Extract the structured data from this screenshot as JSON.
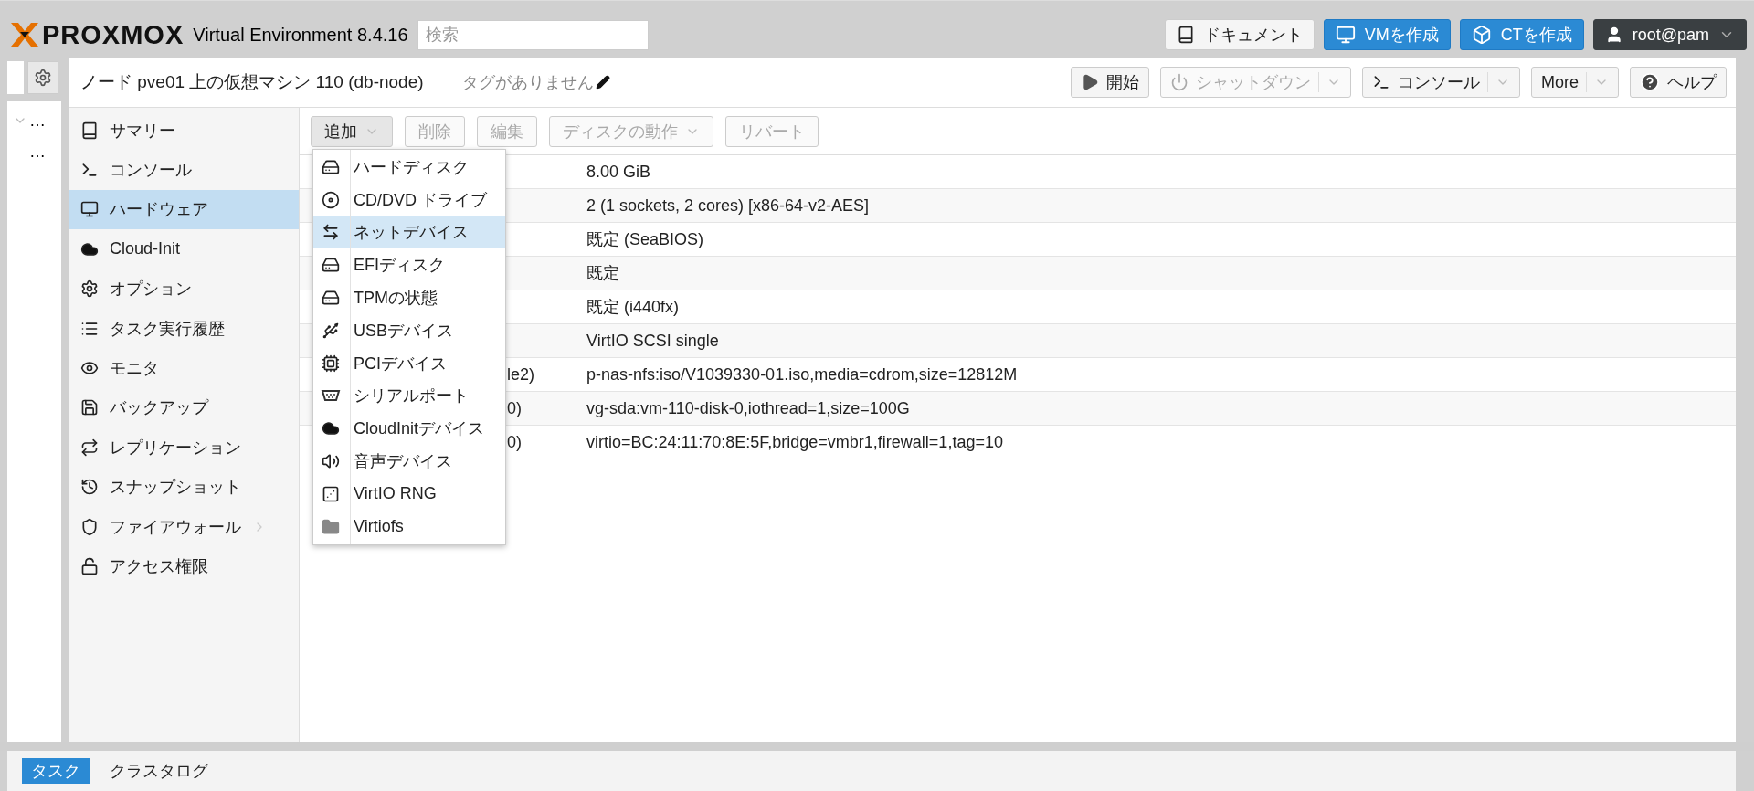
{
  "header": {
    "logo": "PROXMOX",
    "product": "Virtual Environment 8.4.16",
    "search": {
      "placeholder": "検索"
    },
    "buttons": [
      {
        "label": "ドキュメント",
        "kind": "docs"
      },
      {
        "label": "VMを作成",
        "kind": "vm"
      },
      {
        "label": "CTを作成",
        "kind": "ct"
      },
      {
        "label": "root@pam",
        "kind": "user"
      }
    ]
  },
  "tree": [
    {
      "label": "…",
      "expanded": true
    },
    {
      "label": "…",
      "expanded": false
    }
  ],
  "title_bar": {
    "title": "ノード pve01 上の仮想マシン 110 (db-node)",
    "tags": "タグがありません",
    "buttons": [
      {
        "label": "開始",
        "disabled": false,
        "dropdown": false
      },
      {
        "label": "シャットダウン",
        "disabled": true,
        "dropdown": true
      },
      {
        "label": "コンソール",
        "disabled": false,
        "dropdown": true
      },
      {
        "label": "More",
        "disabled": false,
        "dropdown": true
      },
      {
        "label": "ヘルプ",
        "disabled": false,
        "dropdown": false
      }
    ]
  },
  "nav": [
    {
      "label": "サマリー",
      "selected": false,
      "submenu": false
    },
    {
      "label": "コンソール",
      "selected": false,
      "submenu": false
    },
    {
      "label": "ハードウェア",
      "selected": true,
      "submenu": false
    },
    {
      "label": "Cloud-Init",
      "selected": false,
      "submenu": false
    },
    {
      "label": "オプション",
      "selected": false,
      "submenu": false
    },
    {
      "label": "タスク実行履歴",
      "selected": false,
      "submenu": false
    },
    {
      "label": "モニタ",
      "selected": false,
      "submenu": false
    },
    {
      "label": "バックアップ",
      "selected": false,
      "submenu": false
    },
    {
      "label": "レプリケーション",
      "selected": false,
      "submenu": false
    },
    {
      "label": "スナップショット",
      "selected": false,
      "submenu": false
    },
    {
      "label": "ファイアウォール",
      "selected": false,
      "submenu": true
    },
    {
      "label": "アクセス権限",
      "selected": false,
      "submenu": false
    }
  ],
  "toolbar": [
    {
      "label": "追加",
      "disabled": false,
      "dropdown": true
    },
    {
      "label": "削除",
      "disabled": true,
      "dropdown": false
    },
    {
      "label": "編集",
      "disabled": true,
      "dropdown": false
    },
    {
      "label": "ディスクの動作",
      "disabled": true,
      "dropdown": true
    },
    {
      "label": "リバート",
      "disabled": true,
      "dropdown": false
    }
  ],
  "add_menu": [
    {
      "label": "ハードディスク",
      "selected": false
    },
    {
      "label": "CD/DVD ドライブ",
      "selected": false
    },
    {
      "label": "ネットデバイス",
      "selected": true
    },
    {
      "label": "EFIディスク",
      "selected": false
    },
    {
      "label": "TPMの状態",
      "selected": false
    },
    {
      "label": "USBデバイス",
      "selected": false
    },
    {
      "label": "PCIデバイス",
      "selected": false
    },
    {
      "label": "シリアルポート",
      "selected": false
    },
    {
      "label": "CloudInitデバイス",
      "selected": false
    },
    {
      "label": "音声デバイス",
      "selected": false
    },
    {
      "label": "VirtIO RNG",
      "selected": false
    },
    {
      "label": "Virtiofs",
      "selected": false
    }
  ],
  "table": {
    "rows": [
      {
        "value": "8.00 GiB"
      },
      {
        "value": "2 (1 sockets, 2 cores) [x86-64-v2-AES]"
      },
      {
        "value": "既定 (SeaBIOS)"
      },
      {
        "value": "既定"
      },
      {
        "value": "既定 (i440fx)"
      },
      {
        "value": "VirtIO SCSI single"
      },
      {
        "key": "le2)",
        "value": "p-nas-nfs:iso/V1039330-01.iso,media=cdrom,size=12812M"
      },
      {
        "key": "0)",
        "value": "vg-sda:vm-110-disk-0,iothread=1,size=100G"
      },
      {
        "key": "0)",
        "value": "virtio=BC:24:11:70:8E:5F,bridge=vmbr1,firewall=1,tag=10"
      }
    ]
  },
  "bottom_tabs": [
    {
      "label": "タスク",
      "selected": true
    },
    {
      "label": "クラスタログ",
      "selected": false
    }
  ]
}
